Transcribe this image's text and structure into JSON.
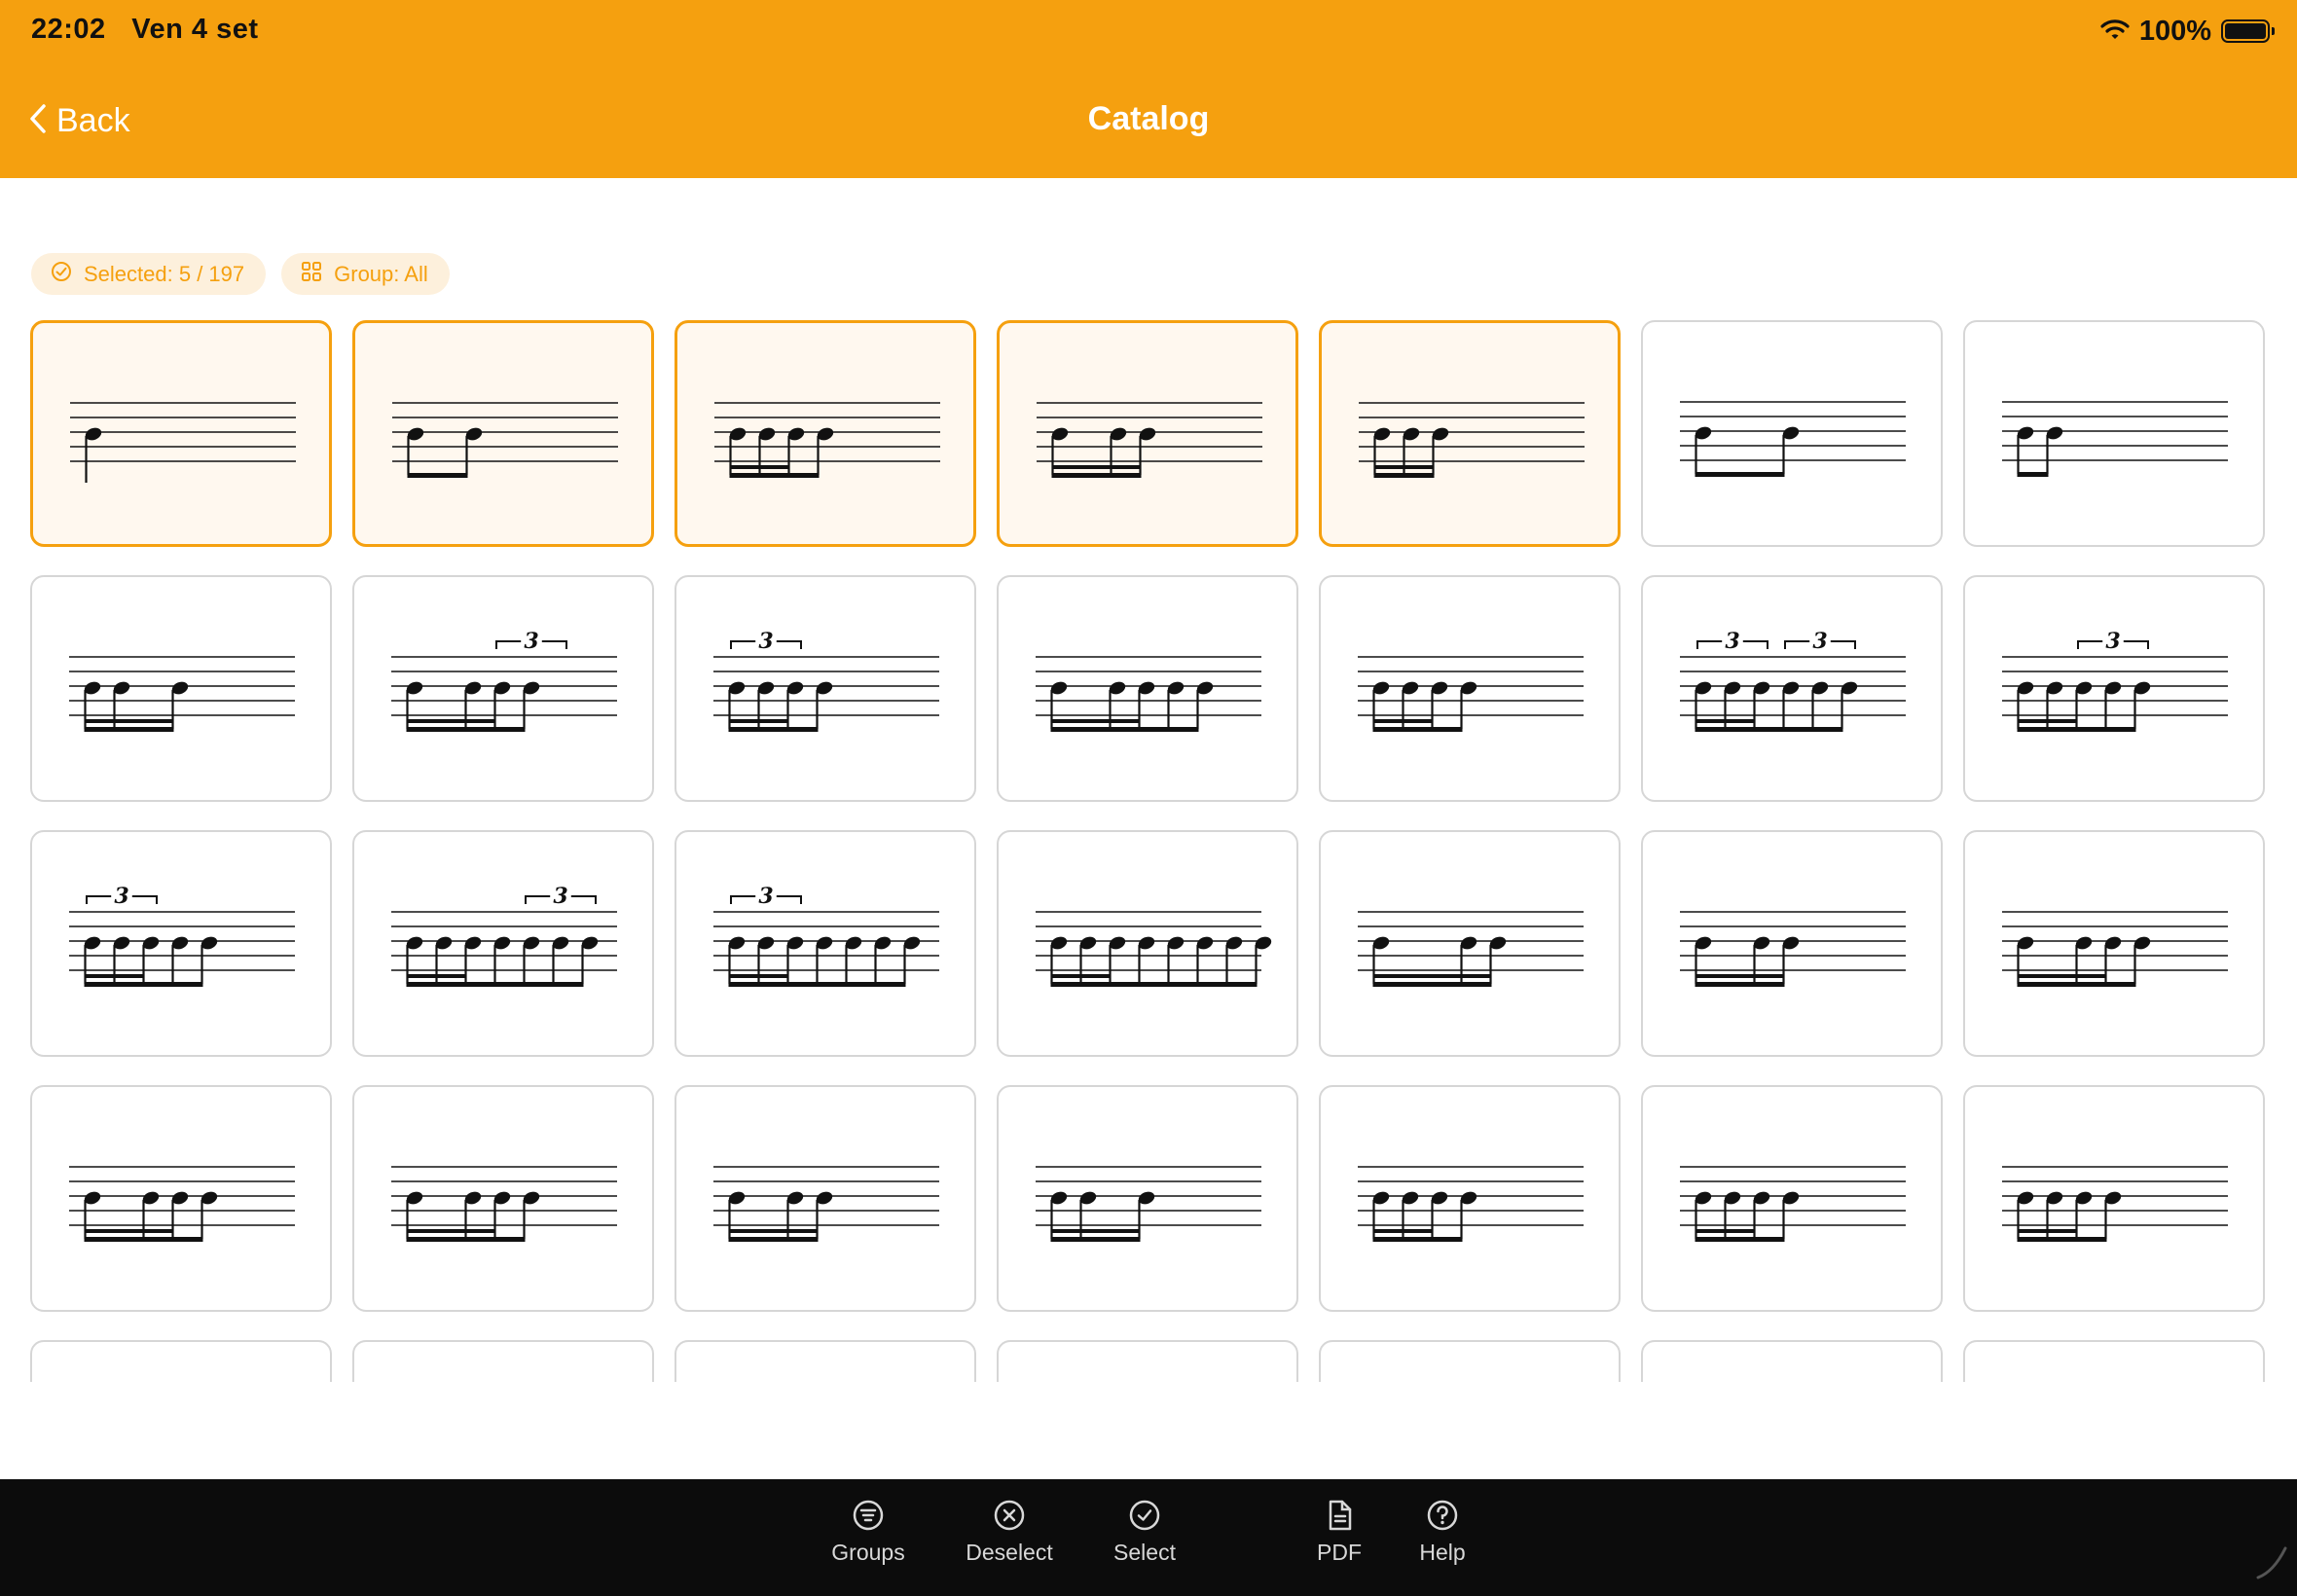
{
  "status_bar": {
    "time": "22:02",
    "date": "Ven 4 set",
    "battery": "100%",
    "battery_level": 1.0
  },
  "nav": {
    "back_label": "Back",
    "title": "Catalog"
  },
  "chips": {
    "selected": "Selected: 5 / 197",
    "group": "Group: All"
  },
  "tuplet_label": "3",
  "colors": {
    "accent": "#f5a00f",
    "toolbar": "#0c0c0c",
    "selected_card_bg": "#fff8ef"
  },
  "rhythm_cards": [
    {
      "selected": true,
      "notes": [
        0
      ],
      "triplets": []
    },
    {
      "selected": true,
      "notes": [
        0,
        2
      ],
      "triplets": []
    },
    {
      "selected": true,
      "notes": [
        0,
        1,
        2,
        3
      ],
      "triplets": []
    },
    {
      "selected": true,
      "notes": [
        0,
        2,
        3
      ],
      "triplets": []
    },
    {
      "selected": true,
      "notes": [
        0,
        1,
        2
      ],
      "triplets": []
    },
    {
      "selected": false,
      "notes": [
        0,
        3
      ],
      "triplets": []
    },
    {
      "selected": false,
      "notes": [
        0,
        1
      ],
      "triplets": []
    },
    {
      "selected": false,
      "notes": [
        0,
        1,
        3
      ],
      "triplets": []
    },
    {
      "selected": false,
      "notes": [
        0,
        2,
        3,
        4
      ],
      "triplets": [
        2
      ]
    },
    {
      "selected": false,
      "notes": [
        0,
        1,
        2,
        3
      ],
      "triplets": [
        0
      ]
    },
    {
      "selected": false,
      "notes": [
        0,
        2,
        3,
        4,
        5
      ],
      "triplets": []
    },
    {
      "selected": false,
      "notes": [
        0,
        1,
        2,
        3
      ],
      "triplets": []
    },
    {
      "selected": false,
      "notes": [
        0,
        1,
        2,
        3,
        4,
        5
      ],
      "triplets": [
        0,
        3
      ]
    },
    {
      "selected": false,
      "notes": [
        0,
        1,
        2,
        3,
        4
      ],
      "triplets": [
        2
      ]
    },
    {
      "selected": false,
      "notes": [
        0,
        1,
        2,
        3,
        4
      ],
      "triplets": [
        0
      ]
    },
    {
      "selected": false,
      "notes": [
        0,
        1,
        2,
        3,
        4,
        5,
        6
      ],
      "triplets": [
        4
      ]
    },
    {
      "selected": false,
      "notes": [
        0,
        1,
        2,
        3,
        4,
        5,
        6
      ],
      "triplets": [
        0
      ]
    },
    {
      "selected": false,
      "notes": [
        0,
        1,
        2,
        3,
        4,
        5,
        6,
        7
      ],
      "triplets": []
    },
    {
      "selected": false,
      "notes": [
        0,
        3,
        4
      ],
      "triplets": []
    },
    {
      "selected": false,
      "notes": [
        0,
        2,
        3
      ],
      "triplets": []
    },
    {
      "selected": false,
      "notes": [
        0,
        2,
        3,
        4
      ],
      "triplets": []
    },
    {
      "selected": false,
      "notes": [
        0,
        2,
        3,
        4
      ],
      "triplets": []
    },
    {
      "selected": false,
      "notes": [
        0,
        2,
        3,
        4
      ],
      "triplets": []
    },
    {
      "selected": false,
      "notes": [
        0,
        2,
        3
      ],
      "triplets": []
    },
    {
      "selected": false,
      "notes": [
        0,
        1,
        3
      ],
      "triplets": []
    },
    {
      "selected": false,
      "notes": [
        0,
        1,
        2,
        3
      ],
      "triplets": []
    },
    {
      "selected": false,
      "notes": [
        0,
        1,
        2,
        3
      ],
      "triplets": []
    },
    {
      "selected": false,
      "notes": [
        0,
        1,
        2,
        3
      ],
      "triplets": []
    },
    {
      "selected": false,
      "notes": [],
      "triplets": []
    },
    {
      "selected": false,
      "notes": [],
      "triplets": []
    },
    {
      "selected": false,
      "notes": [],
      "triplets": []
    },
    {
      "selected": false,
      "notes": [],
      "triplets": []
    },
    {
      "selected": false,
      "notes": [],
      "triplets": []
    },
    {
      "selected": false,
      "notes": [],
      "triplets": []
    },
    {
      "selected": false,
      "notes": [],
      "triplets": []
    }
  ],
  "toolbar": [
    {
      "label": "Groups",
      "icon": "list-circle-icon"
    },
    {
      "label": "Deselect",
      "icon": "x-circle-icon"
    },
    {
      "label": "Select",
      "icon": "check-circle-icon"
    },
    {
      "label": "PDF",
      "icon": "document-icon"
    },
    {
      "label": "Help",
      "icon": "question-circle-icon"
    }
  ]
}
